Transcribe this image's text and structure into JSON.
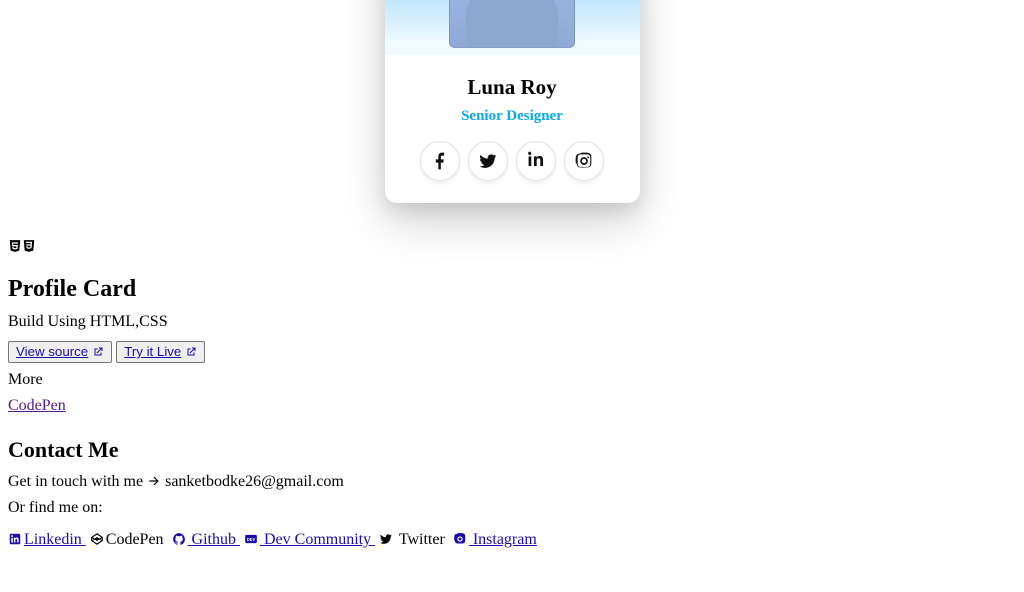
{
  "card": {
    "name": "Luna Roy",
    "role": "Senior Designer"
  },
  "doc": {
    "title": "Profile Card",
    "subtitle": "Build Using HTML,CSS",
    "buttons": {
      "view_source": "View source",
      "try_live": "Try it Live"
    },
    "more_label": "More",
    "codepen_link": "CodePen",
    "contact_heading": "Contact Me",
    "contact_line_prefix": "Get in touch with me",
    "email": "sanketbodke26@gmail.com",
    "find_me": "Or find me on:",
    "links": {
      "linkedin": "Linkedin",
      "codepen": "CodePen",
      "github": "Github",
      "dev": "Dev Community",
      "twitter": "Twitter",
      "instagram": "Instagram"
    }
  }
}
